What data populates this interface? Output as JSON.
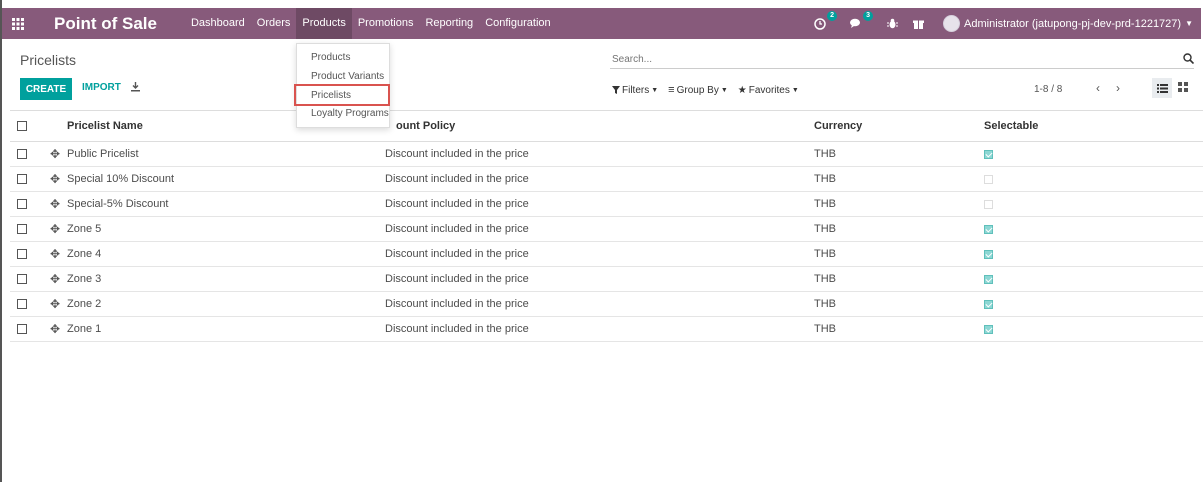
{
  "navbar": {
    "app_title": "Point of Sale",
    "menu": [
      "Dashboard",
      "Orders",
      "Products",
      "Promotions",
      "Reporting",
      "Configuration"
    ],
    "active_menu": "Products",
    "activity_badge": "2",
    "messages_badge": "3",
    "user_name": "Administrator (jatupong-pj-dev-prd-1221727)"
  },
  "control_panel": {
    "title": "Pricelists",
    "create_label": "CREATE",
    "import_label": "IMPORT",
    "search_placeholder": "Search...",
    "filters_label": "Filters",
    "groupby_label": "Group By",
    "favorites_label": "Favorites",
    "pager": "1-8 / 8"
  },
  "products_dropdown": {
    "items": [
      "Products",
      "Product Variants",
      "Pricelists",
      "Loyalty Programs"
    ],
    "highlighted": "Pricelists"
  },
  "table": {
    "headers": {
      "name": "Pricelist Name",
      "discount": "ount Policy",
      "currency": "Currency",
      "selectable": "Selectable"
    },
    "rows": [
      {
        "name": "Public Pricelist",
        "discount": "Discount included in the price",
        "currency": "THB",
        "selectable": true
      },
      {
        "name": "Special 10% Discount",
        "discount": "Discount included in the price",
        "currency": "THB",
        "selectable": false
      },
      {
        "name": "Special-5% Discount",
        "discount": "Discount included in the price",
        "currency": "THB",
        "selectable": false
      },
      {
        "name": "Zone 5",
        "discount": "Discount included in the price",
        "currency": "THB",
        "selectable": true
      },
      {
        "name": "Zone 4",
        "discount": "Discount included in the price",
        "currency": "THB",
        "selectable": true
      },
      {
        "name": "Zone 3",
        "discount": "Discount included in the price",
        "currency": "THB",
        "selectable": true
      },
      {
        "name": "Zone 2",
        "discount": "Discount included in the price",
        "currency": "THB",
        "selectable": true
      },
      {
        "name": "Zone 1",
        "discount": "Discount included in the price",
        "currency": "THB",
        "selectable": true
      }
    ]
  },
  "colors": {
    "navbar": "#875a7b",
    "accent": "#00a09d",
    "highlight_border": "#d9534f"
  }
}
